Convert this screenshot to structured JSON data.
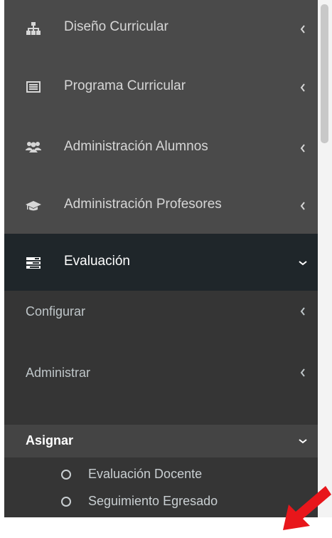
{
  "sidebar": {
    "items": [
      {
        "label": "Diseño Curricular",
        "icon": "sitemap-icon"
      },
      {
        "label": "Programa Curricular",
        "icon": "list-alt-icon"
      },
      {
        "label": "Administración Alumnos",
        "icon": "users-icon"
      },
      {
        "label": "Administración Profesores",
        "icon": "graduation-cap-icon"
      }
    ],
    "active": {
      "label": "Evaluación",
      "icon": "tasks-icon"
    },
    "submenu": {
      "items": [
        {
          "label": "Configurar"
        },
        {
          "label": "Administrar"
        }
      ],
      "open": {
        "label": "Asignar"
      },
      "leaves": [
        {
          "label": "Evaluación Docente"
        },
        {
          "label": "Seguimiento Egresado"
        }
      ]
    }
  },
  "colors": {
    "sidebar_bg": "#4a4a4a",
    "active_header_bg": "#1f262a",
    "submenu_bg": "#353535",
    "open_submenu_bg": "#444444",
    "annotation_arrow": "#e8161b"
  }
}
